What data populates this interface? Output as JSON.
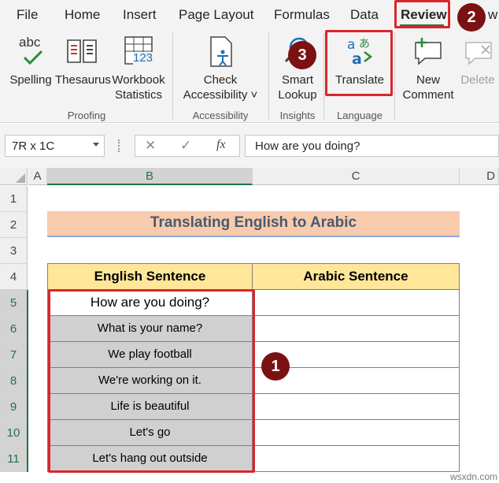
{
  "menu": {
    "tabs": [
      "File",
      "Home",
      "Insert",
      "Page Layout",
      "Formulas",
      "Data",
      "Review",
      "w"
    ]
  },
  "ribbon": {
    "spelling": "Spelling",
    "spelling_icon_text": "abc",
    "thesaurus": "Thesaurus",
    "workbook_stats": [
      "Workbook",
      "Statistics"
    ],
    "workbook_icon_text": "123",
    "check_accessibility": [
      "Check",
      "Accessibility ˅"
    ],
    "smart_lookup": [
      "Smart",
      "Lookup"
    ],
    "translate": "Translate",
    "new_comment": [
      "New",
      "Comment"
    ],
    "delete": "Delete",
    "groups": [
      "Proofing",
      "Accessibility",
      "Insights",
      "Language"
    ]
  },
  "formula_bar": {
    "name_box": "7R x 1C",
    "fx": "fx",
    "formula": "How are you doing?"
  },
  "sheet": {
    "columns": [
      "A",
      "B",
      "C",
      "D"
    ],
    "rows": [
      "1",
      "2",
      "3",
      "4",
      "5",
      "6",
      "7",
      "8",
      "9",
      "10",
      "11"
    ],
    "title": "Translating English to Arabic",
    "header_english": "English Sentence",
    "header_arabic": "Arabic Sentence",
    "english": [
      "How are you doing?",
      "What is your name?",
      "We play football",
      "We're working on it.",
      "Life is beautiful",
      "Let's go",
      "Let's hang out outside"
    ]
  },
  "callouts": [
    "1",
    "2",
    "3"
  ],
  "watermark": "wsxdn.com",
  "colors": {
    "accent": "#217346",
    "title_fill": "#f8cbad",
    "header_fill": "#ffe699",
    "selection_fill": "#d0d0d0",
    "callout": "#7b1111",
    "highlight_box": "#d9262b"
  }
}
